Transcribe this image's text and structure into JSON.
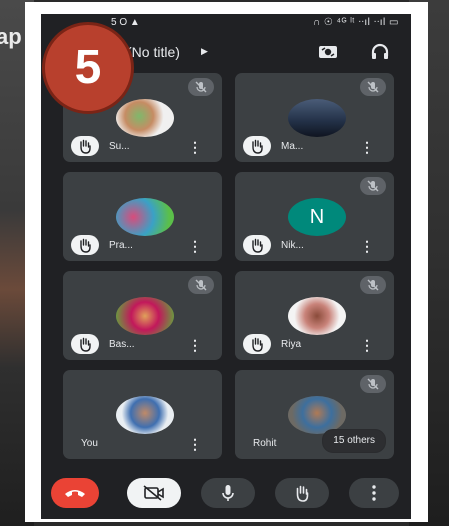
{
  "backdrop": {
    "text": "ap"
  },
  "status_bar": {
    "left": "5 O ▲",
    "right": "∩ ☉ ⁴ᴳ ˡᵗ ᐧᐧıl ᐧᐧıl ▭"
  },
  "top_bar": {
    "title": "(No title)",
    "title_caret_icon": "caret-right-icon",
    "icons": [
      "camera-switch-icon",
      "headphones-icon"
    ]
  },
  "step_badge": "5",
  "participants": [
    {
      "name": "Su...",
      "initial": "",
      "muted": true,
      "hand_icon": "raise-hand-icon",
      "avatar_colors": [
        "#f0f0f0",
        "#7fb86b",
        "#c68c64"
      ]
    },
    {
      "name": "Ma...",
      "initial": "",
      "muted": true,
      "hand_icon": "raise-hand-icon",
      "avatar_colors": [
        "#223046",
        "#4a5c78",
        "#0f1420"
      ]
    },
    {
      "name": "Pra...",
      "initial": "",
      "muted": false,
      "hand_icon": "raise-hand-icon",
      "avatar_colors": [
        "#3aa1c6",
        "#d94c7b",
        "#5bbf4a"
      ]
    },
    {
      "name": "Nik...",
      "initial": "N",
      "muted": true,
      "hand_icon": "raise-hand-icon",
      "avatar_colors": [
        "#00897b"
      ]
    },
    {
      "name": "Bas...",
      "initial": "",
      "muted": true,
      "hand_icon": "raise-hand-icon",
      "avatar_colors": [
        "#c2185b",
        "#6a9b3f",
        "#e0a15a"
      ]
    },
    {
      "name": "Riya",
      "initial": "",
      "muted": true,
      "hand_icon": "raise-hand-icon",
      "avatar_colors": [
        "#f4f4f4",
        "#c9837a",
        "#8a4b3a"
      ]
    },
    {
      "name": "You",
      "initial": "",
      "muted": false,
      "hand_icon": "",
      "avatar_colors": [
        "#e9eef2",
        "#3f6fb0",
        "#c08a68"
      ]
    },
    {
      "name": "Rohit",
      "initial": "",
      "muted": true,
      "hand_icon": "",
      "avatar_colors": [
        "#6d6a64",
        "#3d6f9e",
        "#b07a55"
      ],
      "others_label": "15 others"
    }
  ],
  "controls": {
    "end_call": {
      "icon": "end-call-icon",
      "color": "#ea4335"
    },
    "camera": {
      "icon": "camera-off-icon",
      "color": "#f1f3f4"
    },
    "mic": {
      "icon": "microphone-icon",
      "color": "#3c4043"
    },
    "raise_hand": {
      "icon": "raise-hand-icon",
      "color": "#3c4043"
    },
    "more": {
      "icon": "more-vertical-icon",
      "color": "#3c4043"
    }
  }
}
